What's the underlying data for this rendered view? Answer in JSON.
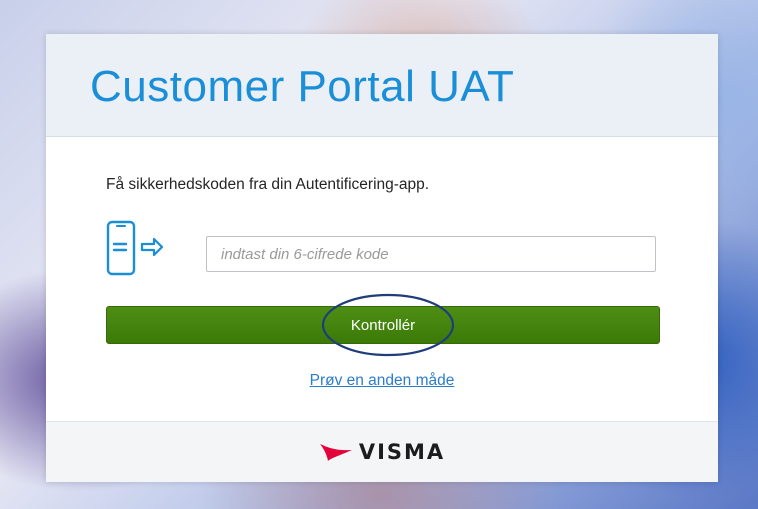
{
  "card": {
    "title": "Customer Portal UAT",
    "instruction": "Få sikkerhedskoden fra din Autentificering-app.",
    "code_input": {
      "value": "",
      "placeholder": "indtast din 6-cifrede kode"
    },
    "verify_button_label": "Kontrollér",
    "other_way_link": "Prøv en anden måde",
    "phone_icon": "phone-arrow-icon"
  },
  "footer": {
    "logo_text": "VISMA",
    "logo_icon": "visma-swoosh-icon"
  },
  "colors": {
    "title": "#1b8ed8",
    "button": "#3f7f0c",
    "link": "#2b7cc9",
    "logo_mark": "#e4003b",
    "annotation_ellipse": "#1f3d7a"
  }
}
